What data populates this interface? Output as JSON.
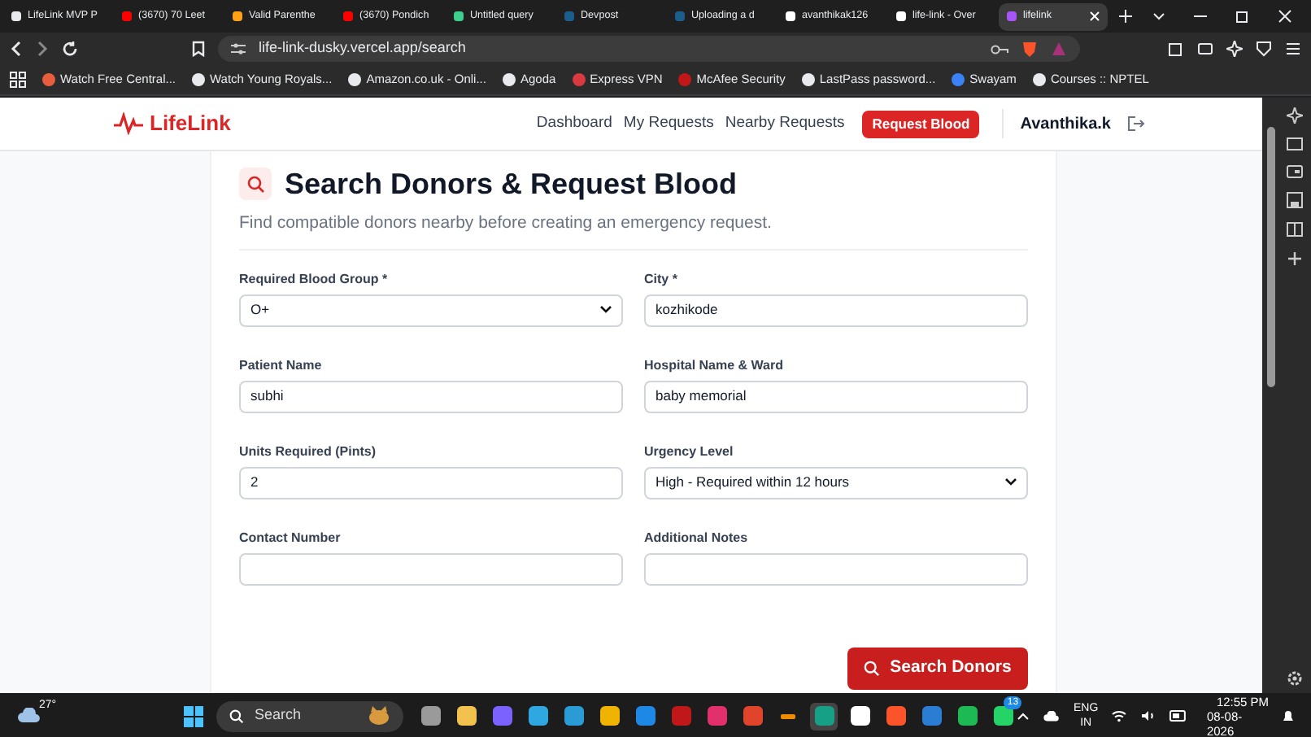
{
  "browser_tabs": [
    {
      "label": "LifeLink MVP P",
      "selected": false,
      "color": "#e8eaed"
    },
    {
      "label": "(3670) 70 Leet",
      "selected": false,
      "color": "#ff0000"
    },
    {
      "label": "Valid Parenthe",
      "selected": false,
      "color": "#ffa116"
    },
    {
      "label": "(3670) Pondich",
      "selected": false,
      "color": "#ff0000"
    },
    {
      "label": "Untitled query",
      "selected": false,
      "color": "#3ecf8e"
    },
    {
      "label": "Devpost",
      "selected": false,
      "color": "#1b5e8c"
    },
    {
      "label": "Uploading a d",
      "selected": false,
      "color": "#1b5e8c"
    },
    {
      "label": "avanthikak126",
      "selected": false,
      "color": "#ffffff"
    },
    {
      "label": "life-link - Over",
      "selected": false,
      "color": "#ffffff"
    },
    {
      "label": "lifelink",
      "selected": true,
      "color": "#a855f7"
    }
  ],
  "address": "life-link-dusky.vercel.app/search",
  "bookmarks": [
    {
      "label": "Watch Free Central...",
      "color": "#e85d3c"
    },
    {
      "label": "Watch Young Royals...",
      "color": "#e8eaed"
    },
    {
      "label": "Amazon.co.uk - Onli...",
      "color": "#e8eaed"
    },
    {
      "label": "Agoda",
      "color": "#e8eaed"
    },
    {
      "label": "Express VPN",
      "color": "#da3940"
    },
    {
      "label": "McAfee Security",
      "color": "#c01818"
    },
    {
      "label": "LastPass password...",
      "color": "#e8eaed"
    },
    {
      "label": "Swayam",
      "color": "#3b82f6"
    },
    {
      "label": "Courses :: NPTEL",
      "color": "#e8eaed"
    }
  ],
  "app": {
    "logo": "LifeLink",
    "nav": [
      {
        "label": "Dashboard",
        "kind": "link"
      },
      {
        "label": "My Requests",
        "kind": "link"
      },
      {
        "label": "Nearby Requests",
        "kind": "link"
      },
      {
        "label": "Request Blood",
        "kind": "button"
      }
    ],
    "user": "Avanthika.k"
  },
  "page": {
    "title": "Search Donors & Request Blood",
    "subtitle": "Find compatible donors nearby before creating an emergency request.",
    "fields": [
      {
        "label": "Required Blood Group *",
        "kind": "select",
        "value": "O+"
      },
      {
        "label": "City *",
        "kind": "input",
        "value": "kozhikode"
      },
      {
        "label": "Patient Name",
        "kind": "input",
        "value": "subhi"
      },
      {
        "label": "Hospital Name & Ward",
        "kind": "input",
        "value": "baby memorial"
      },
      {
        "label": "Units Required (Pints)",
        "kind": "input",
        "value": "2"
      },
      {
        "label": "Urgency Level",
        "kind": "select",
        "value": "High - Required within 12 hours"
      },
      {
        "label": "Contact Number",
        "kind": "input"
      },
      {
        "label": "Additional Notes",
        "kind": "input"
      }
    ],
    "submit": "Search Donors"
  },
  "taskbar": {
    "weather": "27°",
    "search": "Search",
    "badge": "13",
    "lang": "ENG",
    "region": "IN",
    "time": "12:55 PM",
    "date": "08-08-2026"
  }
}
